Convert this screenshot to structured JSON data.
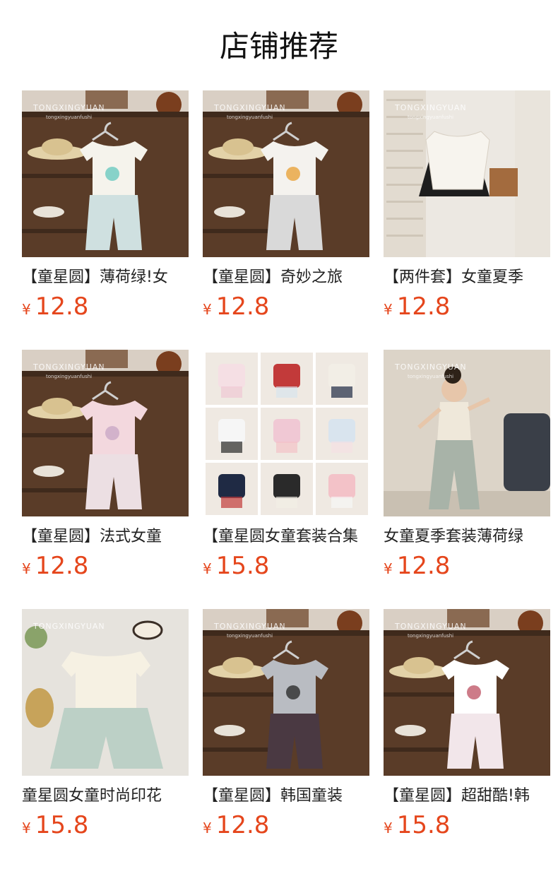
{
  "header": {
    "title": "店铺推荐"
  },
  "colors": {
    "price": "#e5461c",
    "title": "#111111"
  },
  "products": [
    {
      "name": "【童星圆】薄荷绿!女",
      "currency": "¥",
      "price": "12.8",
      "thumb": "shelf",
      "top": "#f5f3ec",
      "bottom": "#cfe0e0",
      "accent": "#6bc9c0",
      "watermark": "TONGXINGYUAN",
      "watermark_sub": "tongxingyuanfushi"
    },
    {
      "name": "【童星圆】奇妙之旅",
      "currency": "¥",
      "price": "12.8",
      "thumb": "shelf",
      "top": "#f4f2ee",
      "bottom": "#d9d9d9",
      "accent": "#e9a23b",
      "watermark": "TONGXINGYUAN",
      "watermark_sub": "tongxingyuanfushi"
    },
    {
      "name": "【两件套】女童夏季",
      "currency": "¥",
      "price": "12.8",
      "thumb": "closet",
      "top": "#f7f4ee",
      "bottom": "#1e1e1e",
      "accent": "#d8cfc2",
      "watermark": "TONGXINGYUAN",
      "watermark_sub": "tongxingyuanfushi"
    },
    {
      "name": "【童星圆】法式女童",
      "currency": "¥",
      "price": "12.8",
      "thumb": "shelf",
      "top": "#f3d8de",
      "bottom": "#ecdfe3",
      "accent": "#c9a9c6",
      "watermark": "TONGXINGYUAN",
      "watermark_sub": "tongxingyuanfushi"
    },
    {
      "name": "【童星圆女童套装合集",
      "currency": "¥",
      "price": "15.8",
      "thumb": "collage",
      "top": "#ffffff",
      "bottom": "#f0c8d0",
      "accent": "#b04a4a",
      "watermark": "",
      "watermark_sub": ""
    },
    {
      "name": "女童夏季套装薄荷绿",
      "currency": "¥",
      "price": "12.8",
      "thumb": "girl",
      "top": "#e8e2d8",
      "bottom": "#a8b3a8",
      "accent": "#3a3f48",
      "watermark": "TONGXINGYUAN",
      "watermark_sub": "tongxingyuanfushi"
    },
    {
      "name": "童星圆女童时尚印花",
      "currency": "¥",
      "price": "15.8",
      "thumb": "flat",
      "top": "#f6f1e3",
      "bottom": "#bcd0c6",
      "accent": "#8a9a7e",
      "watermark": "TONGXINGYUAN",
      "watermark_sub": ""
    },
    {
      "name": "【童星圆】韩国童装",
      "currency": "¥",
      "price": "12.8",
      "thumb": "shelf",
      "top": "#b9bcc2",
      "bottom": "#4a3942",
      "accent": "#2d2d2d",
      "watermark": "TONGXINGYUAN",
      "watermark_sub": "tongxingyuanfushi"
    },
    {
      "name": "【童星圆】超甜酷!韩",
      "currency": "¥",
      "price": "15.8",
      "thumb": "shelf",
      "top": "#ffffff",
      "bottom": "#f2e6ea",
      "accent": "#c05a6a",
      "watermark": "TONGXINGYUAN",
      "watermark_sub": "tongxingyuanfushi"
    }
  ]
}
